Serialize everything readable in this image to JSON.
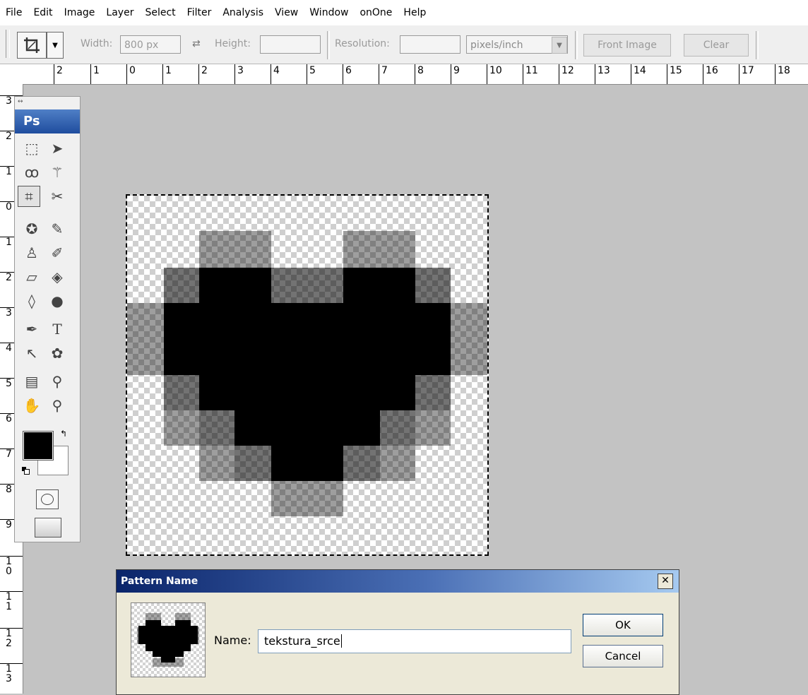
{
  "menu": [
    "File",
    "Edit",
    "Image",
    "Layer",
    "Select",
    "Filter",
    "Analysis",
    "View",
    "Window",
    "onOne",
    "Help"
  ],
  "options": {
    "width_label": "Width:",
    "width_value": "800 px",
    "swap_icon": "swap-arrows-icon",
    "height_label": "Height:",
    "height_value": "",
    "resolution_label": "Resolution:",
    "resolution_value": "",
    "units_value": "pixels/inch",
    "front_image": "Front Image",
    "clear": "Clear"
  },
  "ruler_h": [
    "2",
    "1",
    "0",
    "1",
    "2",
    "3",
    "4",
    "5",
    "6",
    "7",
    "8",
    "9",
    "10",
    "11",
    "12",
    "13",
    "14",
    "15",
    "16",
    "17",
    "18"
  ],
  "ruler_v": [
    "3",
    "2",
    "1",
    "0",
    "1",
    "2",
    "3",
    "4",
    "5",
    "6",
    "7",
    "8",
    "9"
  ],
  "ruler_v_stacked": [
    [
      "1",
      "0"
    ],
    [
      "1",
      "1"
    ],
    [
      "1",
      "2"
    ],
    [
      "1",
      "3"
    ]
  ],
  "toolbox": {
    "title": "Ps",
    "tools": [
      "marquee-icon",
      "move-icon",
      "lasso-icon",
      "magic-wand-icon",
      "crop-icon",
      "slice-icon",
      "healing-icon",
      "brush-icon",
      "clone-stamp-icon",
      "history-brush-icon",
      "eraser-icon",
      "paint-bucket-icon",
      "blur-icon",
      "dodge-icon",
      "pen-icon",
      "type-icon",
      "path-select-icon",
      "shape-icon",
      "notes-icon",
      "eyedropper-icon",
      "hand-icon",
      "zoom-icon"
    ],
    "foreground_color": "#000000",
    "background_color": "#ffffff"
  },
  "dialog": {
    "title": "Pattern Name",
    "name_label": "Name:",
    "name_value": "tekstura_srce",
    "ok": "OK",
    "cancel": "Cancel"
  }
}
